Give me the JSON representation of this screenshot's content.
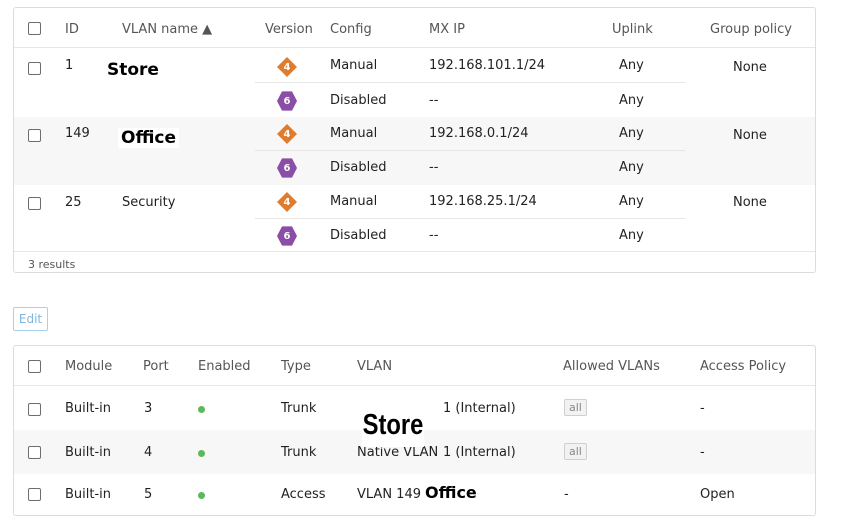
{
  "vlan_table": {
    "columns": {
      "id": "ID",
      "name": "VLAN name ▲",
      "version": "Version",
      "config": "Config",
      "mx_ip": "MX IP",
      "uplink": "Uplink",
      "group_policy": "Group policy"
    },
    "rows": [
      {
        "id": "1",
        "name": "Store",
        "v4": {
          "badge": "4",
          "config": "Manual",
          "ip": "192.168.101.1/24",
          "uplink": "Any"
        },
        "v6": {
          "badge": "6",
          "config": "Disabled",
          "ip": "--",
          "uplink": "Any"
        },
        "policy": "None"
      },
      {
        "id": "149",
        "name": "Office",
        "v4": {
          "badge": "4",
          "config": "Manual",
          "ip": "192.168.0.1/24",
          "uplink": "Any"
        },
        "v6": {
          "badge": "6",
          "config": "Disabled",
          "ip": "--",
          "uplink": "Any"
        },
        "policy": "None"
      },
      {
        "id": "25",
        "name": "Security",
        "v4": {
          "badge": "4",
          "config": "Manual",
          "ip": "192.168.25.1/24",
          "uplink": "Any"
        },
        "v6": {
          "badge": "6",
          "config": "Disabled",
          "ip": "--",
          "uplink": "Any"
        },
        "policy": "None"
      }
    ],
    "results": "3 results"
  },
  "edit_button": "Edit",
  "port_table": {
    "columns": {
      "module": "Module",
      "port": "Port",
      "enabled": "Enabled",
      "type": "Type",
      "vlan": "VLAN",
      "allowed": "Allowed VLANs",
      "policy": "Access Policy"
    },
    "rows": [
      {
        "module": "Built-in",
        "port": "3",
        "type": "Trunk",
        "vlan_tail": "1 (Internal)",
        "allowed": "all",
        "policy": "-"
      },
      {
        "module": "Built-in",
        "port": "4",
        "type": "Trunk",
        "vlan_partial": "Native VLAN",
        "vlan_tail": "1 (Internal)",
        "allowed": "all",
        "policy": "-"
      },
      {
        "module": "Built-in",
        "port": "5",
        "type": "Access",
        "vlan_head": "VLAN 149",
        "vlan_overlay": "Office",
        "allowed": "-",
        "policy": "Open"
      }
    ],
    "overlay_label": "Store"
  },
  "colors": {
    "ipv4": "#e07c2e",
    "ipv6": "#8b4ea6",
    "enabled": "#5cb85c",
    "accent": "#7fb6de"
  }
}
